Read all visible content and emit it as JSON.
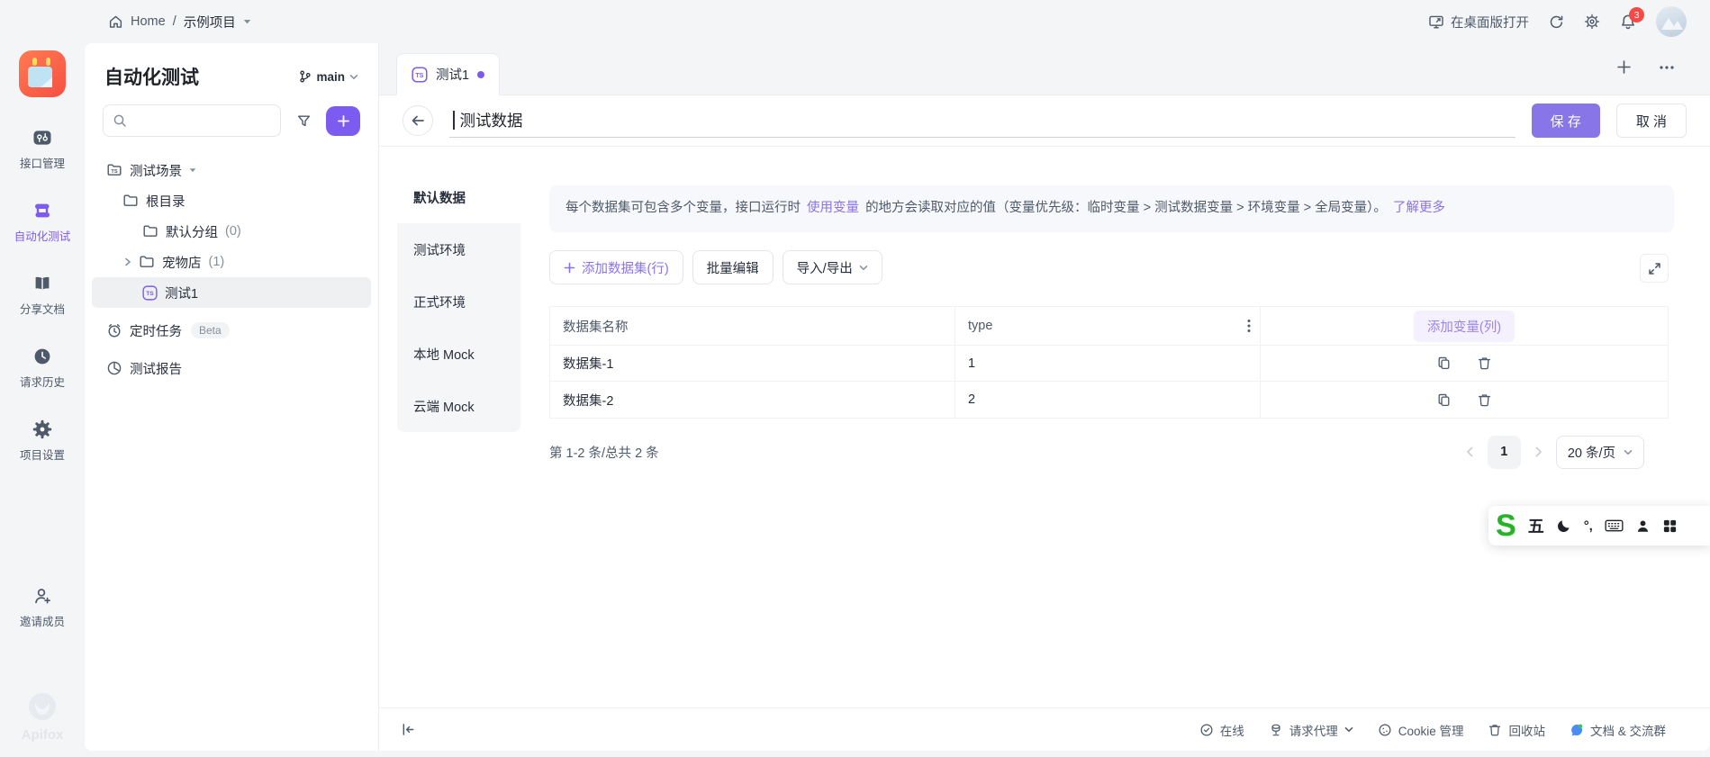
{
  "colors": {
    "accent": "#7C5BF0",
    "save_button": "#8876E8",
    "badge_red": "#F54A45",
    "logo_orange": "#F8523F",
    "ime_green": "#27B327"
  },
  "topbar": {
    "home": "Home",
    "sep": "/",
    "project": "示例项目",
    "open_desktop": "在桌面版打开",
    "notification_count": "3"
  },
  "iconbar": {
    "items": [
      {
        "label": "接口管理"
      },
      {
        "label": "自动化测试"
      },
      {
        "label": "分享文档"
      },
      {
        "label": "请求历史"
      },
      {
        "label": "项目设置"
      }
    ],
    "invite": "邀请成员",
    "brand": "Apifox"
  },
  "panel": {
    "title": "自动化测试",
    "branch": "main",
    "tree": [
      {
        "label": "测试场景"
      },
      {
        "label": "根目录"
      },
      {
        "label": "默认分组",
        "count": "(0)"
      },
      {
        "label": "宠物店",
        "count": "(1)"
      },
      {
        "label": "测试1"
      },
      {
        "label": "定时任务",
        "badge": "Beta"
      },
      {
        "label": "测试报告"
      }
    ]
  },
  "tabbar": {
    "active_tab": "测试1"
  },
  "header": {
    "title": "测试数据",
    "save": "保 存",
    "cancel": "取 消"
  },
  "env_tabs": [
    {
      "label": "默认数据"
    },
    {
      "label": "测试环境"
    },
    {
      "label": "正式环境"
    },
    {
      "label": "本地 Mock"
    },
    {
      "label": "云端 Mock"
    }
  ],
  "banner": {
    "text_pre": "每个数据集可包含多个变量，接口运行时",
    "link_use": "使用变量",
    "text_mid": "的地方会读取对应的值（变量优先级：临时变量 > 测试数据变量 > 环境变量 > 全局变量）。",
    "link_more": "了解更多"
  },
  "toolbar": {
    "add_row": "添加数据集(行)",
    "batch_edit": "批量编辑",
    "import_export": "导入/导出"
  },
  "table": {
    "col_name": "数据集名称",
    "col_type": "type",
    "add_col": "添加变量(列)",
    "rows": [
      {
        "name": "数据集-1",
        "type": "1"
      },
      {
        "name": "数据集-2",
        "type": "2"
      }
    ]
  },
  "pagination": {
    "summary": "第 1-2 条/总共 2 条",
    "page": "1",
    "size": "20 条/页"
  },
  "ime": {
    "logo": "S",
    "mode": "五",
    "punct": "°,"
  },
  "statusbar": {
    "online": "在线",
    "proxy": "请求代理",
    "cookie": "Cookie 管理",
    "recycle": "回收站",
    "docs": "文档 & 交流群"
  }
}
